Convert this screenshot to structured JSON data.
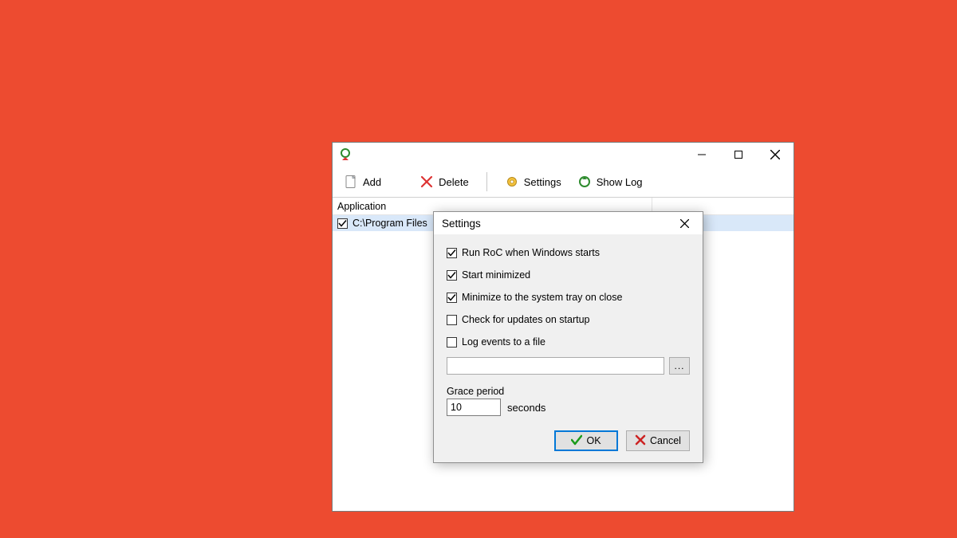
{
  "background_color": "#ed4b30",
  "main_window": {
    "toolbar": {
      "add": "Add",
      "delete": "Delete",
      "settings": "Settings",
      "showlog": "Show Log"
    },
    "columns": {
      "application": "Application"
    },
    "rows": [
      {
        "checked": true,
        "path": "C:\\Program Files"
      }
    ]
  },
  "dialog": {
    "title": "Settings",
    "options": [
      {
        "label": "Run RoC when Windows starts",
        "checked": true
      },
      {
        "label": "Start minimized",
        "checked": true
      },
      {
        "label": "Minimize to the system tray on close",
        "checked": true
      },
      {
        "label": "Check for updates on startup",
        "checked": false
      },
      {
        "label": "Log events to a file",
        "checked": false
      }
    ],
    "log_path": "",
    "browse_label": "...",
    "grace_label": "Grace period",
    "grace_value": "10",
    "grace_unit": "seconds",
    "ok": "OK",
    "cancel": "Cancel"
  }
}
